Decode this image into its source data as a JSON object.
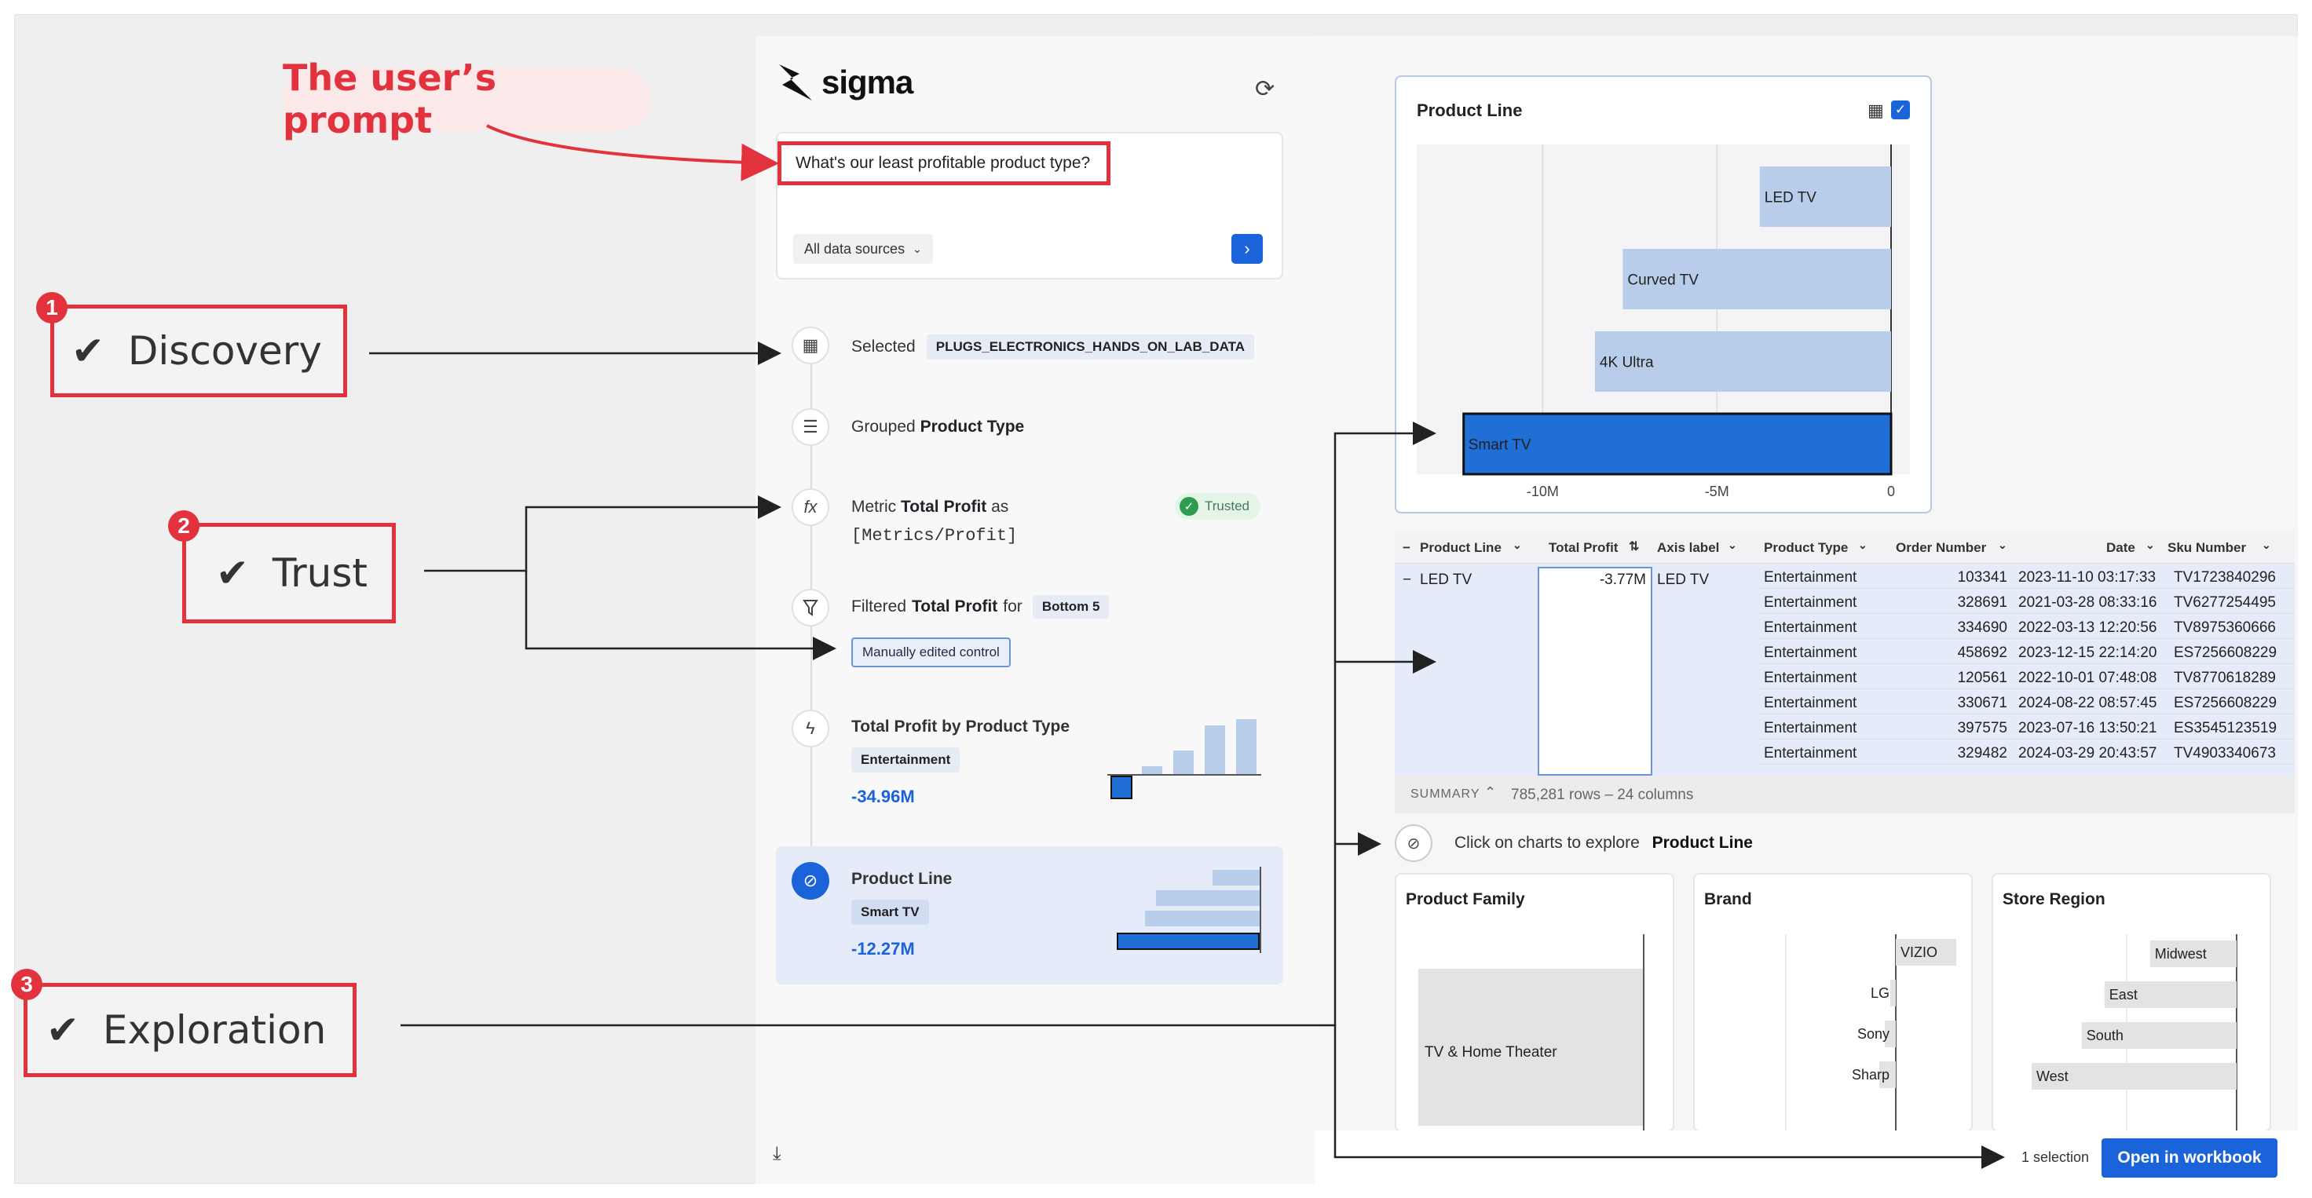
{
  "annotations": {
    "prompt_label": "The user’s prompt",
    "discovery": {
      "num": "1",
      "label": "Discovery"
    },
    "trust": {
      "num": "2",
      "label": "Trust"
    },
    "exploration": {
      "num": "3",
      "label": "Exploration"
    },
    "check": "✔"
  },
  "app": {
    "logo_text": "sigma",
    "prompt_text": "What's our least profitable product type?",
    "data_source_select": "All data sources",
    "steps": [
      {
        "icon": "table-icon",
        "prefix": "Selected",
        "chip": "PLUGS_ELECTRONICS_HANDS_ON_LAB_DATA"
      },
      {
        "icon": "group-icon",
        "prefix": "Grouped",
        "bold": "Product Type"
      },
      {
        "icon": "function-icon",
        "prefix": "Metric",
        "bold": "Total Profit",
        "suffix": "as",
        "code": "[Metrics/Profit]",
        "badge": "Trusted"
      },
      {
        "icon": "filter-icon",
        "prefix": "Filtered",
        "bold": "Total Profit",
        "suffix": "for",
        "chip": "Bottom 5",
        "control": "Manually edited control"
      },
      {
        "icon": "lightning-icon",
        "title": "Total Profit by Product Type",
        "chip": "Entertainment",
        "value": "-34.96M"
      },
      {
        "icon": "compass-icon",
        "title": "Product Line",
        "chip": "Smart TV",
        "value": "-12.27M"
      }
    ]
  },
  "product_line_chart": {
    "title": "Product Line",
    "chart_data": {
      "type": "bar",
      "orientation": "horizontal",
      "categories": [
        "LED TV",
        "Curved TV",
        "4K Ultra",
        "Smart TV"
      ],
      "values": [
        -3.77,
        -7.7,
        -8.5,
        -12.27
      ],
      "unit": "M",
      "highlighted": "Smart TV",
      "x_ticks": [
        "-10M",
        "-5M",
        "0"
      ],
      "xlim": [
        -13.3,
        0
      ]
    }
  },
  "table": {
    "headers": [
      "Product Line",
      "Total Profit",
      "Axis label",
      "Product Type",
      "Order Number",
      "Date",
      "Sku Number"
    ],
    "group_label": "LED TV",
    "group_profit": "-3.77M",
    "group_axis": "LED TV",
    "rows": [
      [
        "Entertainment",
        "103341",
        "2023-11-10 03:17:33",
        "TV1723840296"
      ],
      [
        "Entertainment",
        "328691",
        "2021-03-28 08:33:16",
        "TV6277254495"
      ],
      [
        "Entertainment",
        "334690",
        "2022-03-13 12:20:56",
        "TV8975360666"
      ],
      [
        "Entertainment",
        "458692",
        "2023-12-15 22:14:20",
        "ES7256608229"
      ],
      [
        "Entertainment",
        "120561",
        "2022-10-01 07:48:08",
        "TV8770618289"
      ],
      [
        "Entertainment",
        "330671",
        "2024-08-22 08:57:45",
        "ES7256608229"
      ],
      [
        "Entertainment",
        "397575",
        "2023-07-16 13:50:21",
        "ES3545123519"
      ],
      [
        "Entertainment",
        "329482",
        "2024-03-29 20:43:57",
        "TV4903340673"
      ]
    ],
    "summary_label": "SUMMARY",
    "summary_info": "785,281 rows – 24 columns"
  },
  "explore": {
    "prefix": "Click on charts to explore",
    "target": "Product Line"
  },
  "mini_charts": [
    {
      "title": "Product Family",
      "chart_data": {
        "type": "bar",
        "categories": [
          "TV & Home Theater"
        ],
        "values": [
          1
        ]
      }
    },
    {
      "title": "Brand",
      "chart_data": {
        "type": "bar",
        "orientation": "horizontal",
        "categories": [
          "VIZIO",
          "LG",
          "Sony",
          "Sharp"
        ],
        "highlight_positive": [
          "VIZIO"
        ],
        "values": [
          0.55,
          -0.05,
          -0.1,
          -0.15
        ]
      }
    },
    {
      "title": "Store Region",
      "chart_data": {
        "type": "bar",
        "orientation": "horizontal",
        "categories": [
          "Midwest",
          "East",
          "South",
          "West"
        ],
        "values": [
          -0.38,
          -0.58,
          -0.68,
          -0.9
        ]
      }
    }
  ],
  "footer": {
    "selection": "1 selection",
    "open_button": "Open in workbook"
  },
  "colors": {
    "annotation_red": "#e2323d",
    "accent_blue": "#1a63d8",
    "bar_light": "#b8cdea",
    "bar_selected": "#1f6fd6"
  }
}
